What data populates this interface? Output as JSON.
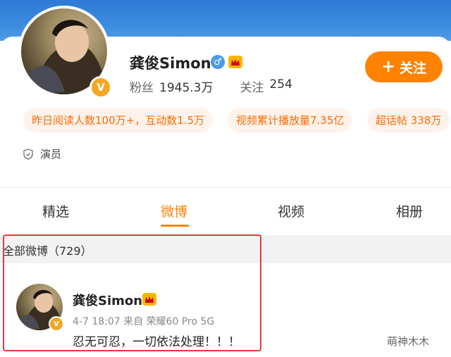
{
  "profile": {
    "name": "龚俊Simon",
    "gender_icon": "♂",
    "fans_label": "粉丝",
    "fans_count": "1945.3万",
    "following_label": "关注",
    "following_count": "254",
    "follow_button": "关注",
    "verify_badge": "V",
    "role": "演员"
  },
  "chips": [
    "昨日阅读人数100万+，互动数1.5万",
    "视频累计播放量7.35亿",
    "超话帖 338万"
  ],
  "tabs": [
    "精选",
    "微博",
    "视频",
    "相册"
  ],
  "active_tab": "微博",
  "feed": {
    "section_title": "全部微博（729）",
    "post": {
      "author": "龚俊Simon",
      "meta": "4-7 18:07  来自 荣耀60 Pro 5G",
      "text": "忍无可忍，一切依法处理！！！"
    }
  },
  "watermark": "萌神木木",
  "colors": {
    "accent": "#ff8200",
    "banner": "#3b8be0",
    "chip_bg": "#fdf3ec",
    "highlight_border": "#e23a3a"
  }
}
